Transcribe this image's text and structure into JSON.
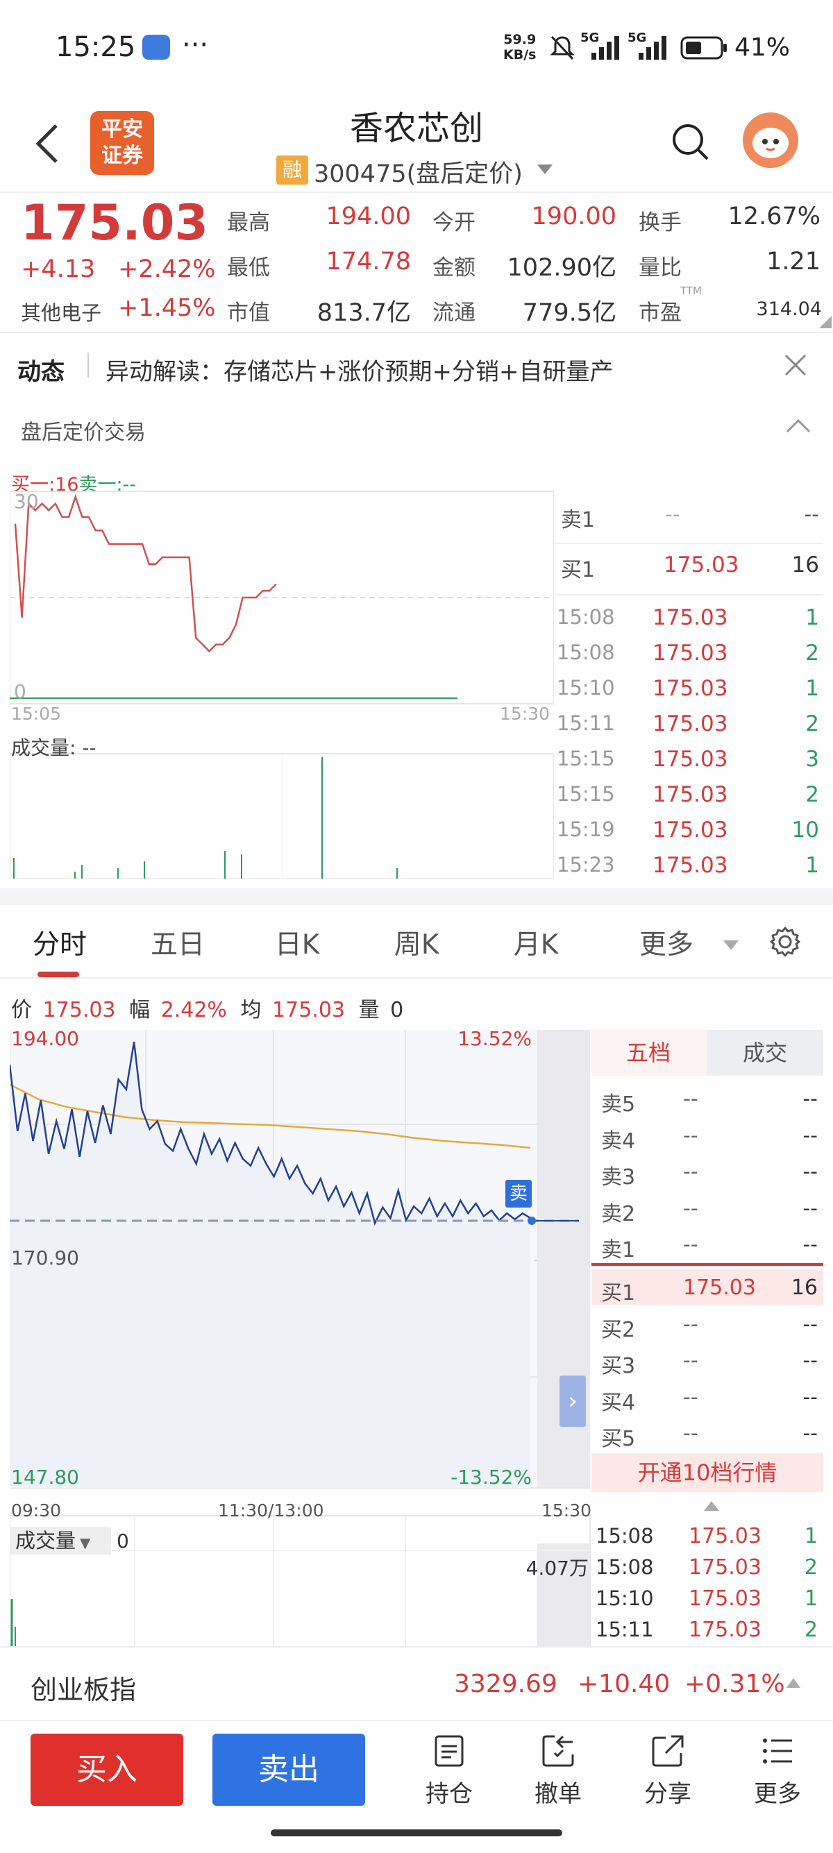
{
  "statusbar": {
    "time": "15:25",
    "more": "···",
    "net_speed_value": "59.9",
    "net_speed_unit": "KB/s",
    "signal1": "5G",
    "signal2": "5G",
    "battery": "41%"
  },
  "header": {
    "title": "香农芯创",
    "badge": "融",
    "code_line": "300475(盘后定价)",
    "logo_line1": "平安",
    "logo_line2": "证券"
  },
  "quote": {
    "price": "175.03",
    "change": "+4.13",
    "change_pct": "+2.42%",
    "sector": "其他电子",
    "sector_pct": "+1.45%",
    "high_label": "最高",
    "high": "194.00",
    "open_label": "今开",
    "open": "190.00",
    "turnover_label": "换手",
    "turnover": "12.67%",
    "low_label": "最低",
    "low": "174.78",
    "amount_label": "金额",
    "amount": "102.90亿",
    "vol_ratio_label": "量比",
    "vol_ratio": "1.21",
    "mcap_label": "市值",
    "mcap": "813.7亿",
    "float_label": "流通",
    "float": "779.5亿",
    "pe_label": "市盈",
    "pe_sup": "TTM",
    "pe": "314.04"
  },
  "news": {
    "label": "动态",
    "text": "异动解读：存储芯片+涨价预期+分销+自研量产"
  },
  "after_hours": {
    "title": "盘后定价交易",
    "buy_sell_line_buy": "买一:16",
    "buy_sell_line_sell": "卖一:--",
    "ymax": "30",
    "ymin": "0",
    "x_start": "15:05",
    "x_end": "15:30",
    "vol_label": "成交量: --",
    "sell1": {
      "label": "卖1",
      "price": "--",
      "vol": "--"
    },
    "buy1": {
      "label": "买1",
      "price": "175.03",
      "vol": "16"
    },
    "trades": [
      {
        "t": "15:08",
        "p": "175.03",
        "v": "1"
      },
      {
        "t": "15:08",
        "p": "175.03",
        "v": "2"
      },
      {
        "t": "15:10",
        "p": "175.03",
        "v": "1"
      },
      {
        "t": "15:11",
        "p": "175.03",
        "v": "2"
      },
      {
        "t": "15:15",
        "p": "175.03",
        "v": "3"
      },
      {
        "t": "15:15",
        "p": "175.03",
        "v": "2"
      },
      {
        "t": "15:19",
        "p": "175.03",
        "v": "10"
      },
      {
        "t": "15:23",
        "p": "175.03",
        "v": "1"
      }
    ]
  },
  "tabs": [
    "分时",
    "五日",
    "日K",
    "周K",
    "月K",
    "更多"
  ],
  "intraday": {
    "info_price_label": "价",
    "info_price": "175.03",
    "info_pct_label": "幅",
    "info_pct": "2.42%",
    "info_avg_label": "均",
    "info_avg": "175.03",
    "info_vol_label": "量",
    "info_vol": "0",
    "ymax": "194.00",
    "ymid": "170.90",
    "ymin": "147.80",
    "pct_max": "13.52%",
    "pct_min": "-13.52%",
    "x_start": "09:30",
    "x_mid": "11:30/13:00",
    "x_end": "15:30",
    "sell_tag": "卖",
    "vol_label": "成交量",
    "vol_value": "0",
    "vol_max": "4.07万"
  },
  "depth": {
    "tab_five": "五档",
    "tab_trade": "成交",
    "sells": [
      {
        "label": "卖5",
        "price": "--",
        "vol": "--"
      },
      {
        "label": "卖4",
        "price": "--",
        "vol": "--"
      },
      {
        "label": "卖3",
        "price": "--",
        "vol": "--"
      },
      {
        "label": "卖2",
        "price": "--",
        "vol": "--"
      },
      {
        "label": "卖1",
        "price": "--",
        "vol": "--"
      }
    ],
    "buys": [
      {
        "label": "买1",
        "price": "175.03",
        "vol": "16"
      },
      {
        "label": "买2",
        "price": "--",
        "vol": "--"
      },
      {
        "label": "买3",
        "price": "--",
        "vol": "--"
      },
      {
        "label": "买4",
        "price": "--",
        "vol": "--"
      },
      {
        "label": "买5",
        "price": "--",
        "vol": "--"
      }
    ],
    "open10": "开通10档行情",
    "trades": [
      {
        "t": "15:08",
        "p": "175.03",
        "v": "1"
      },
      {
        "t": "15:08",
        "p": "175.03",
        "v": "2"
      },
      {
        "t": "15:10",
        "p": "175.03",
        "v": "1"
      },
      {
        "t": "15:11",
        "p": "175.03",
        "v": "2"
      }
    ]
  },
  "index_bar": {
    "name": "创业板指",
    "value": "3329.69",
    "change": "+10.40",
    "pct": "+0.31%"
  },
  "bottom": {
    "buy": "买入",
    "sell": "卖出",
    "hold": "持仓",
    "cancel": "撤单",
    "share": "分享",
    "more": "更多"
  },
  "colors": {
    "red": "#d33b3b",
    "green": "#2e9b5c",
    "blue": "#2f6fd8",
    "line": "#25408f",
    "avg": "#e6a93a"
  },
  "chart_data": [
    {
      "type": "line",
      "x": [
        "15:05",
        "15:30"
      ],
      "ylim": [
        0,
        30
      ],
      "series": [
        {
          "values": [
            26,
            12,
            29,
            28,
            29,
            28,
            29,
            27,
            27,
            30,
            27,
            27,
            25,
            25,
            23,
            23,
            23,
            23,
            23,
            23,
            20,
            20,
            21,
            21,
            21,
            21,
            21,
            9,
            8,
            7,
            8,
            8,
            9,
            11,
            15,
            15,
            15,
            16,
            16,
            17
          ]
        }
      ]
    },
    {
      "type": "line",
      "x": [
        "09:30",
        "11:30/13:00",
        "15:30"
      ],
      "ylim": [
        147.8,
        194.0
      ],
      "series": [
        {
          "values": [
            190.5,
            183.8,
            187.6,
            182.8,
            186.9,
            181.5,
            184.8,
            182.0,
            186.0,
            181.2,
            185.8,
            182.6,
            186.4,
            183.5,
            189.0,
            188.0,
            192.8,
            186.0,
            184.0,
            184.8,
            182.5,
            181.8,
            184.0,
            182.0,
            180.5,
            183.5,
            181.5,
            183.0,
            180.8,
            182.6,
            181.0,
            180.3,
            182.1,
            180.5,
            179.2,
            181.0,
            179.0,
            180.3,
            178.5,
            177.5,
            179.0,
            176.8,
            178.2,
            176.2,
            177.6,
            175.5,
            177.5,
            174.5,
            176.1,
            175.0,
            177.8,
            174.8,
            176.2,
            175.5,
            177.0,
            175.2,
            176.5,
            175.2,
            176.8,
            175.5,
            176.5,
            175.2,
            175.8,
            174.8,
            175.5,
            174.9,
            175.5,
            175.03
          ]
        },
        {
          "values": [
            188.5,
            187.0,
            186.2,
            185.7,
            185.2,
            184.9,
            184.7,
            184.6,
            184.5,
            184.4,
            184.2,
            184.0,
            183.8,
            183.5,
            183.1,
            182.8,
            182.6,
            182.4,
            182.1
          ]
        }
      ]
    }
  ]
}
